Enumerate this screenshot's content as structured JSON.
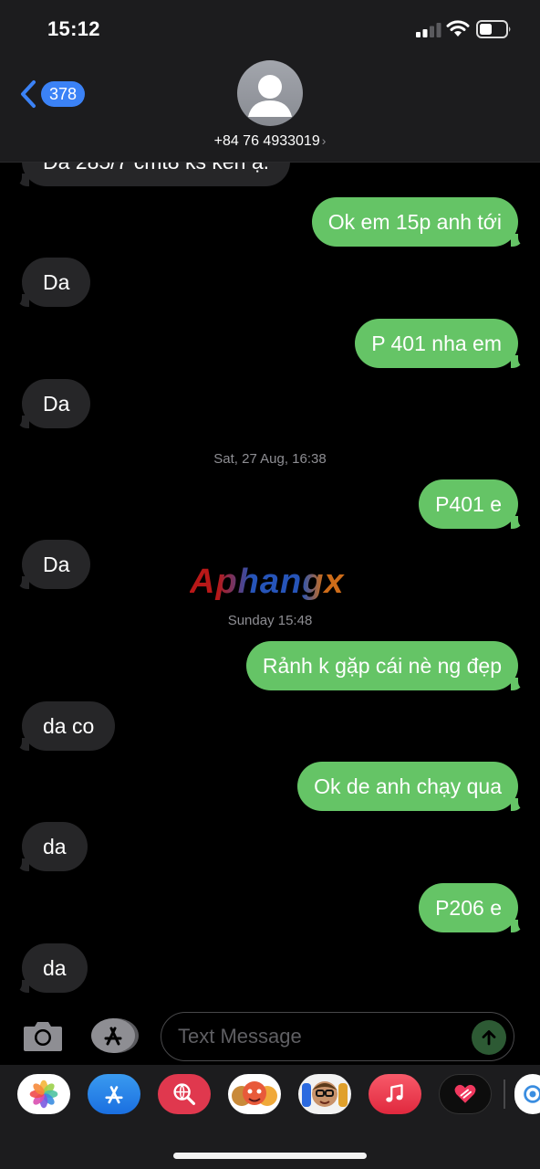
{
  "status_bar": {
    "time": "15:12"
  },
  "header": {
    "back_badge": "378",
    "contact_name": "+84 76 4933019",
    "contact_chevron": "›"
  },
  "messages": [
    {
      "dir": "in",
      "text": "Da 285/7 cmt8 ks ken ạ."
    },
    {
      "dir": "out",
      "text": "Ok em 15p anh tới"
    },
    {
      "dir": "in",
      "text": "Da"
    },
    {
      "dir": "out",
      "text": "P 401 nha em"
    },
    {
      "dir": "in",
      "text": "Da"
    },
    {
      "dir": "out",
      "text": "P401 e"
    },
    {
      "dir": "in",
      "text": "Da"
    },
    {
      "dir": "out",
      "text": "Rảnh k gặp cái nè ng đẹp"
    },
    {
      "dir": "in",
      "text": "da co"
    },
    {
      "dir": "out",
      "text": "Ok de anh chạy qua"
    },
    {
      "dir": "in",
      "text": "da"
    },
    {
      "dir": "out",
      "text": "P206 e"
    },
    {
      "dir": "in",
      "text": "da"
    }
  ],
  "timestamps": [
    "Sat, 27 Aug, 16:38",
    "Sunday 15:48"
  ],
  "watermark": "Aphangx",
  "compose": {
    "placeholder": "Text Message"
  },
  "drawer_apps": [
    "photos-icon",
    "app-store-icon",
    "web-search-icon",
    "animoji-icon",
    "memoji-icon",
    "music-icon",
    "digital-touch-icon",
    "more-apps-icon"
  ],
  "colors": {
    "outgoing": "#65c466",
    "incoming": "#262628",
    "badge": "#3b82f6"
  }
}
